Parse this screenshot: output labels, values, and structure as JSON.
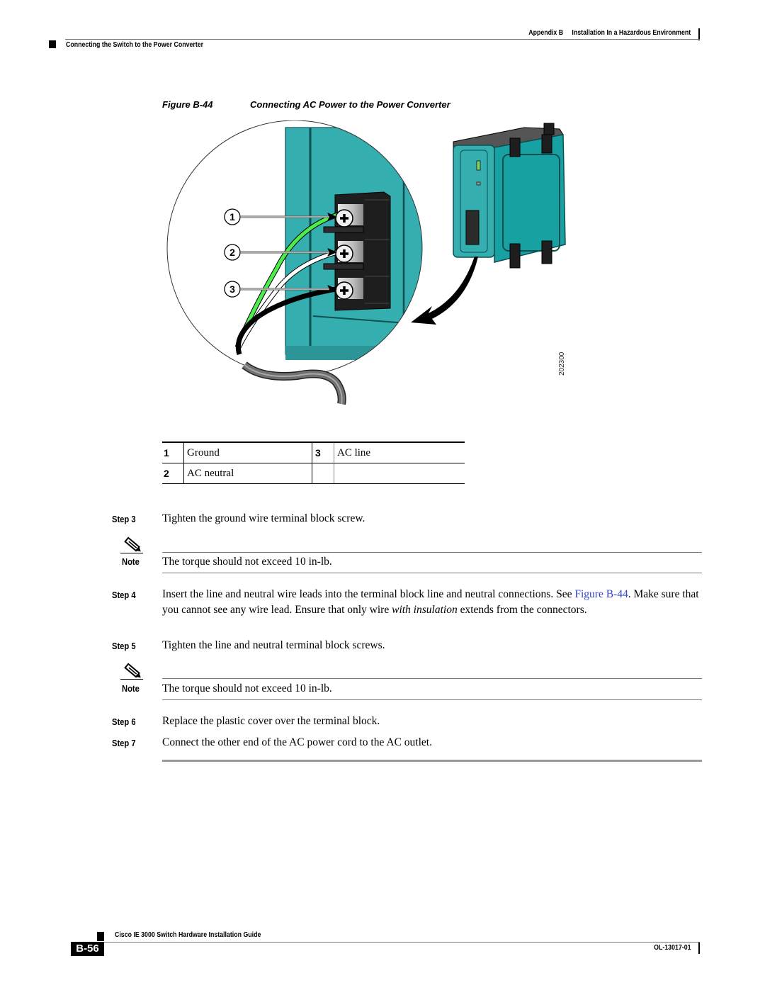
{
  "header": {
    "appendix": "Appendix B",
    "chapter": "Installation In a Hazardous Environment",
    "section": "Connecting the Switch to the Power Converter"
  },
  "figure": {
    "number": "Figure B-44",
    "title": "Connecting AC Power to the Power Converter",
    "callouts": [
      "1",
      "2",
      "3"
    ],
    "art_id": "202300",
    "colors": {
      "converter_teal": "#35aeb0",
      "terminal_block": "#1e1e1e",
      "ground_wire": "#4ded4d",
      "neutral_wire": "#ffffff",
      "line_wire": "#000000",
      "cable_jacket": "#707070"
    }
  },
  "legend": {
    "rows": [
      [
        {
          "num": "1",
          "desc": "Ground"
        },
        {
          "num": "3",
          "desc": "AC line"
        }
      ],
      [
        {
          "num": "2",
          "desc": "AC neutral"
        },
        {
          "num": "",
          "desc": ""
        }
      ]
    ]
  },
  "steps": [
    {
      "label": "Step 3",
      "text": "Tighten the ground wire terminal block screw."
    },
    {
      "label": "Step 4",
      "text_a": "Insert the line and neutral wire leads into the terminal block line and neutral connections. See ",
      "link": "Figure B-44",
      "text_b": ". Make sure that you cannot see any wire lead. Ensure that only wire ",
      "emphasis": "with insulation",
      "text_c": " extends from the connectors."
    },
    {
      "label": "Step 5",
      "text": "Tighten the line and neutral terminal block screws."
    },
    {
      "label": "Step 6",
      "text": "Replace the plastic cover over the terminal block."
    },
    {
      "label": "Step 7",
      "text": "Connect the other end of the AC power cord to the AC outlet."
    }
  ],
  "notes": [
    {
      "label": "Note",
      "text": "The torque should not exceed 10 in-lb."
    },
    {
      "label": "Note",
      "text": "The torque should not exceed 10 in-lb."
    }
  ],
  "footer": {
    "guide_title": "Cisco IE 3000 Switch Hardware Installation Guide",
    "page_number": "B-56",
    "doc_number": "OL-13017-01"
  }
}
